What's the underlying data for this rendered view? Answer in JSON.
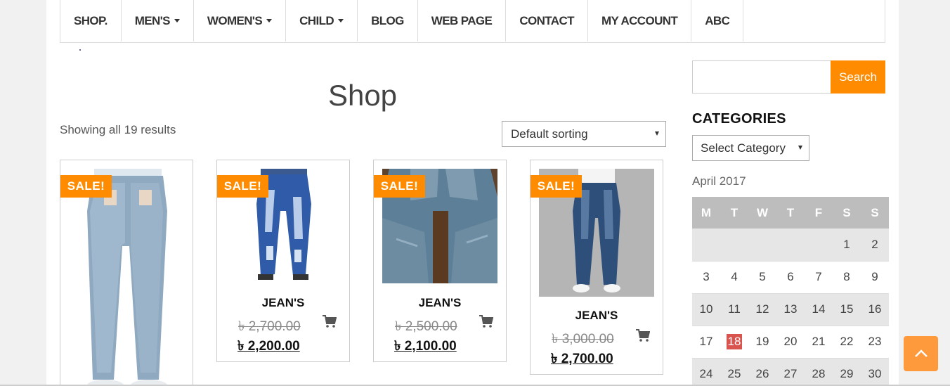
{
  "nav": {
    "items": [
      {
        "label": "SHOP.",
        "caret": false
      },
      {
        "label": "MEN'S",
        "caret": true
      },
      {
        "label": "WOMEN'S",
        "caret": true
      },
      {
        "label": "CHILD",
        "caret": true
      },
      {
        "label": "BLOG",
        "caret": false
      },
      {
        "label": "WEB PAGE",
        "caret": false
      },
      {
        "label": "CONTACT",
        "caret": false
      },
      {
        "label": "MY ACCOUNT",
        "caret": false
      },
      {
        "label": "ABC",
        "caret": false
      }
    ]
  },
  "shop": {
    "title": "Shop",
    "results_text": "Showing all 19 results",
    "sorting": "Default sorting"
  },
  "products": [
    {
      "badge": "SALE!",
      "name": "",
      "old_price": "",
      "new_price": ""
    },
    {
      "badge": "SALE!",
      "name": "JEAN'S",
      "old_price": "৳ 2,700.00",
      "new_price": "৳ 2,200.00"
    },
    {
      "badge": "SALE!",
      "name": "JEAN'S",
      "old_price": "৳ 2,500.00",
      "new_price": "৳ 2,100.00"
    },
    {
      "badge": "SALE!",
      "name": "JEAN'S",
      "old_price": "৳ 3,000.00",
      "new_price": "৳ 2,700.00"
    }
  ],
  "sidebar": {
    "search_button": "Search",
    "categories_title": "CATEGORIES",
    "category_select": "Select Category",
    "calendar": {
      "caption": "April 2017",
      "weekdays": [
        "M",
        "T",
        "W",
        "T",
        "F",
        "S",
        "S"
      ],
      "weeks": [
        [
          "",
          "",
          "",
          "",
          "",
          "1",
          "2"
        ],
        [
          "3",
          "4",
          "5",
          "6",
          "7",
          "8",
          "9"
        ],
        [
          "10",
          "11",
          "12",
          "13",
          "14",
          "15",
          "16"
        ],
        [
          "17",
          "18",
          "19",
          "20",
          "21",
          "22",
          "23"
        ],
        [
          "24",
          "25",
          "26",
          "27",
          "28",
          "29",
          "30"
        ]
      ],
      "today": "18"
    }
  },
  "colors": {
    "accent": "#ff8c00",
    "today": "#d9534f",
    "calendar_header": "#bdbdbd"
  }
}
